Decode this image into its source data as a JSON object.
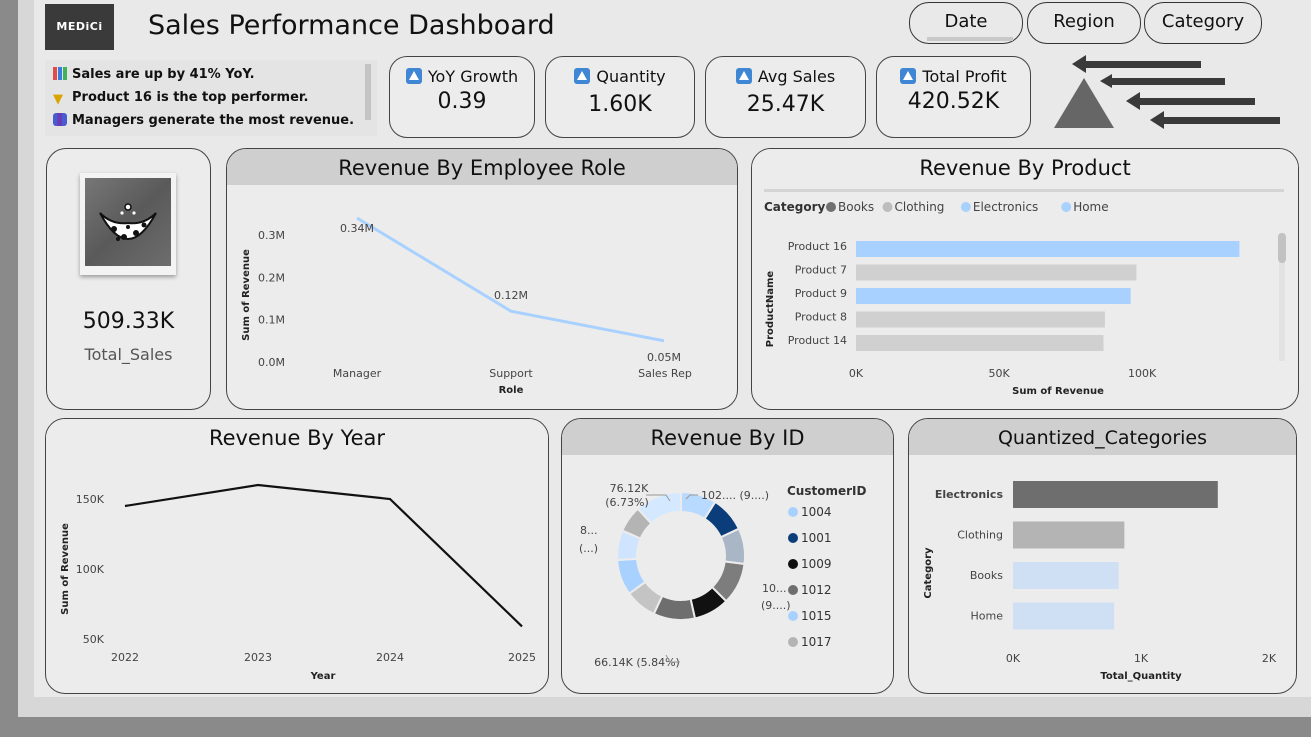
{
  "header": {
    "logo_text": "MEDiCi",
    "title": "Sales Performance Dashboard"
  },
  "slicers": [
    {
      "label": "Date"
    },
    {
      "label": "Region"
    },
    {
      "label": "Category"
    }
  ],
  "insights": [
    {
      "icon": "bar-chart-emoji",
      "text": "Sales are up by 41% YoY."
    },
    {
      "icon": "trophy-emoji",
      "text": "Product 16 is the top performer."
    },
    {
      "icon": "group-emoji",
      "text": "Managers generate the most revenue."
    }
  ],
  "kpis": [
    {
      "label": "YoY Growth",
      "value": "0.39"
    },
    {
      "label": "Quantity",
      "value": "1.60K"
    },
    {
      "label": "Avg Sales",
      "value": "25.47K"
    },
    {
      "label": "Total Profit",
      "value": "420.52K"
    }
  ],
  "total_sales": {
    "value": "509.33K",
    "label": "Total_Sales"
  },
  "colors": {
    "accent": "#3f86d4",
    "light_blue": "#a9d1ff",
    "grey_bar": "#d0d0d0",
    "dark_grey": "#6e6e6e",
    "navy": "#0a3d7a"
  },
  "chart_data": [
    {
      "type": "line",
      "title": "Revenue By Employee Role",
      "xlabel": "Role",
      "ylabel": "Sum of Revenue",
      "categories": [
        "Manager",
        "Support",
        "Sales Rep"
      ],
      "values": [
        0.34,
        0.12,
        0.05
      ],
      "data_labels": [
        "0.34M",
        "0.12M",
        "0.05M"
      ],
      "yticks": [
        "0.0M",
        "0.1M",
        "0.2M",
        "0.3M"
      ],
      "ylim": [
        0,
        0.34
      ]
    },
    {
      "type": "bar",
      "title": "Revenue By Product",
      "legend_title": "Category",
      "legend": [
        "Books",
        "Clothing",
        "Electronics",
        "Home"
      ],
      "ylabel": "ProductName",
      "xlabel": "Sum of Revenue",
      "categories": [
        "Product 16",
        "Product 7",
        "Product 9",
        "Product 8",
        "Product 14"
      ],
      "values": [
        134000,
        98000,
        96000,
        87000,
        86500
      ],
      "bar_categories": [
        "Electronics",
        "Clothing",
        "Electronics",
        "Clothing",
        "Clothing"
      ],
      "xticks": [
        "0K",
        "50K",
        "100K"
      ],
      "xlim": [
        0,
        137000
      ]
    },
    {
      "type": "line",
      "title": "Revenue By Year",
      "xlabel": "Year",
      "ylabel": "Sum of Revenue",
      "categories": [
        "2022",
        "2023",
        "2024",
        "2025"
      ],
      "values": [
        145000,
        160000,
        150000,
        59000
      ],
      "yticks": [
        "50K",
        "100K",
        "150K"
      ],
      "ylim": [
        40000,
        170000
      ]
    },
    {
      "type": "pie",
      "title": "Revenue By ID",
      "legend_title": "CustomerID",
      "legend": [
        "1004",
        "1001",
        "1009",
        "1012",
        "1015",
        "1017"
      ],
      "slices": [
        {
          "value": 9.0,
          "color": "#b9daff"
        },
        {
          "value": 9.0,
          "color": "#0a3d7a"
        },
        {
          "value": 9.0,
          "color": "#a9b6c6"
        },
        {
          "value": 10.5,
          "color": "#7d7d7d"
        },
        {
          "value": 9.0,
          "color": "#111111"
        },
        {
          "value": 10.5,
          "color": "#6e6e6e"
        },
        {
          "value": 8.0,
          "color": "#c4c4c4"
        },
        {
          "value": 9.0,
          "color": "#a9d1ff"
        },
        {
          "value": 7.5,
          "color": "#cfe5ff"
        },
        {
          "value": 6.73,
          "color": "#b4b4b4"
        },
        {
          "value": 11.77,
          "color": "#d4e9ff"
        }
      ],
      "data_labels": [
        "76.12K",
        "(6.73%)",
        "102.... (9....)",
        "8...",
        "(...)",
        "10...",
        "(9....)",
        "66.14K (5.84%)"
      ]
    },
    {
      "type": "bar",
      "title": "Quantized_Categories",
      "ylabel": "Category",
      "xlabel": "Total_Quantity",
      "categories": [
        "Electronics",
        "Clothing",
        "Books",
        "Home"
      ],
      "values": [
        1600,
        870,
        825,
        790
      ],
      "colors": [
        "#6e6e6e",
        "#b4b4b4",
        "#cfe0f5",
        "#cfe0f5"
      ],
      "xticks": [
        "0K",
        "1K",
        "2K"
      ],
      "xlim": [
        0,
        2000
      ]
    }
  ]
}
